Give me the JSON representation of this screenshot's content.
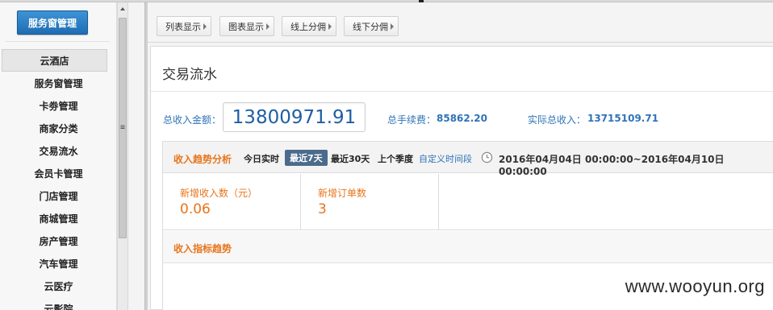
{
  "sidebar": {
    "brand_button": "服务窗管理",
    "items": [
      {
        "label": "云酒店",
        "active": true
      },
      {
        "label": "服务窗管理"
      },
      {
        "label": "卡劵管理"
      },
      {
        "label": "商家分类"
      },
      {
        "label": "交易流水"
      },
      {
        "label": "会员卡管理"
      },
      {
        "label": "门店管理"
      },
      {
        "label": "商城管理"
      },
      {
        "label": "房产管理"
      },
      {
        "label": "汽车管理"
      },
      {
        "label": "云医疗"
      },
      {
        "label": "云影院"
      }
    ]
  },
  "toptabs": [
    "列表显示",
    "图表显示",
    "线上分佣",
    "线下分佣"
  ],
  "page": {
    "title": "交易流水",
    "total_income_label": "总收入金额：",
    "total_income_value": "13800971.91",
    "fee_label": "总手续费：",
    "fee_value": "85862.20",
    "actual_label": "实际总收入：",
    "actual_value": "13715109.71"
  },
  "trend": {
    "title": "收入趋势分析",
    "ranges": [
      "今日实时",
      "最近7天",
      "最近30天",
      "上个季度"
    ],
    "active_range": "最近7天",
    "custom_range": "自定义时间段",
    "date_range": "2016年04月04日 00:00:00~2016年04月10日 00:00:00",
    "stats": [
      {
        "label": "新增收入数（元）",
        "value": "0.06"
      },
      {
        "label": "新增订单数",
        "value": "3"
      }
    ],
    "chart_title": "收入指标趋势"
  },
  "watermark": "www.wooyun.org",
  "colors": {
    "accent_blue": "#2f73b8",
    "orange": "#e8741a",
    "active_range_bg": "#4a6b8c"
  }
}
